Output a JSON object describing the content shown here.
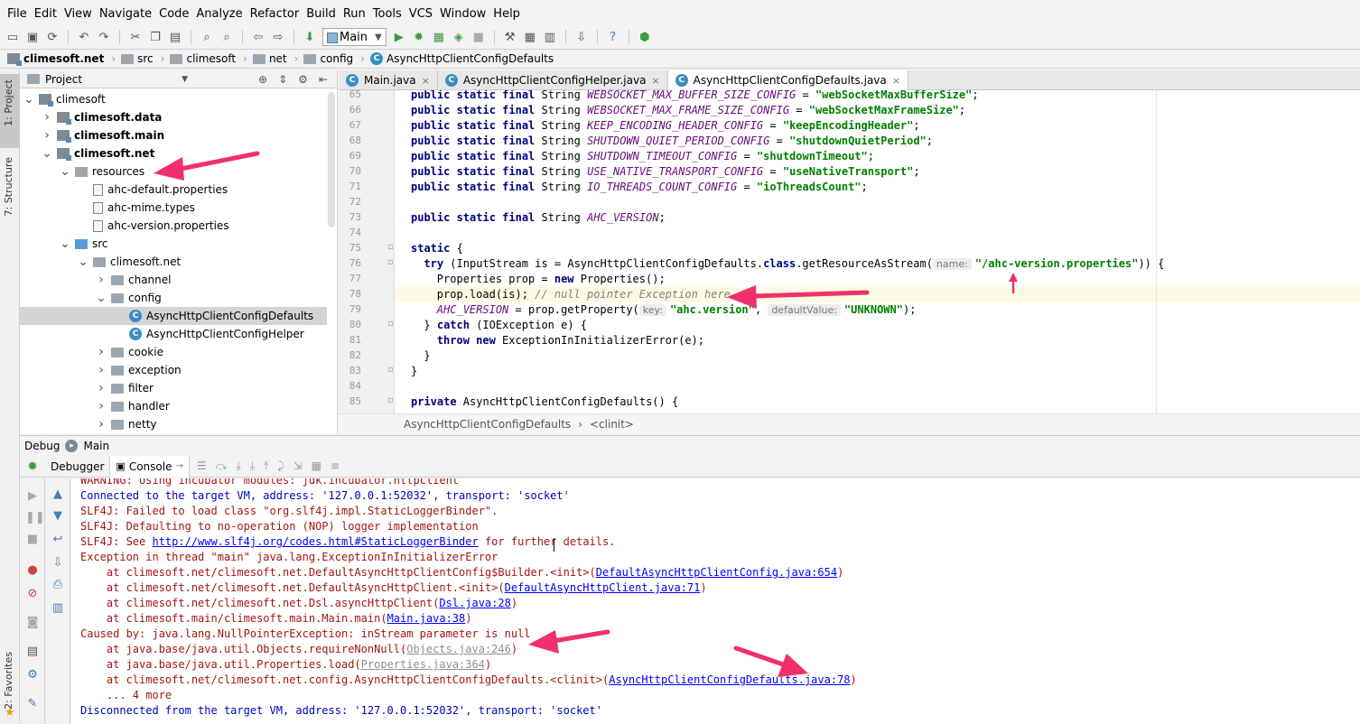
{
  "menu": [
    "File",
    "Edit",
    "View",
    "Navigate",
    "Code",
    "Analyze",
    "Refactor",
    "Build",
    "Run",
    "Tools",
    "VCS",
    "Window",
    "Help"
  ],
  "toolbar": {
    "run_config": "Main"
  },
  "breadcrumbs": [
    "climesoft.net",
    "src",
    "climesoft",
    "net",
    "config",
    "AsyncHttpClientConfigDefaults"
  ],
  "left_strip": {
    "project": "1: Project",
    "structure": "7: Structure",
    "favorites": "2: Favorites"
  },
  "project": {
    "title": "Project",
    "tree": [
      {
        "label": "climesoft",
        "depth": 0,
        "expanded": true,
        "icon": "module"
      },
      {
        "label": "climesoft.data",
        "depth": 1,
        "expanded": false,
        "icon": "module",
        "bold": true
      },
      {
        "label": "climesoft.main",
        "depth": 1,
        "expanded": false,
        "icon": "module",
        "bold": true
      },
      {
        "label": "climesoft.net",
        "depth": 1,
        "expanded": true,
        "icon": "module",
        "bold": true
      },
      {
        "label": "resources",
        "depth": 2,
        "expanded": true,
        "icon": "resources"
      },
      {
        "label": "ahc-default.properties",
        "depth": 3,
        "icon": "file"
      },
      {
        "label": "ahc-mime.types",
        "depth": 3,
        "icon": "file"
      },
      {
        "label": "ahc-version.properties",
        "depth": 3,
        "icon": "file"
      },
      {
        "label": "src",
        "depth": 2,
        "expanded": true,
        "icon": "src"
      },
      {
        "label": "climesoft.net",
        "depth": 3,
        "expanded": true,
        "icon": "folder"
      },
      {
        "label": "channel",
        "depth": 4,
        "expanded": false,
        "icon": "folder"
      },
      {
        "label": "config",
        "depth": 4,
        "expanded": true,
        "icon": "folder"
      },
      {
        "label": "AsyncHttpClientConfigDefaults",
        "depth": 5,
        "icon": "class",
        "selected": true
      },
      {
        "label": "AsyncHttpClientConfigHelper",
        "depth": 5,
        "icon": "class"
      },
      {
        "label": "cookie",
        "depth": 4,
        "expanded": false,
        "icon": "folder"
      },
      {
        "label": "exception",
        "depth": 4,
        "expanded": false,
        "icon": "folder"
      },
      {
        "label": "filter",
        "depth": 4,
        "expanded": false,
        "icon": "folder"
      },
      {
        "label": "handler",
        "depth": 4,
        "expanded": false,
        "icon": "folder"
      },
      {
        "label": "netty",
        "depth": 4,
        "expanded": false,
        "icon": "folder"
      }
    ]
  },
  "editor": {
    "tabs": [
      {
        "label": "Main.java",
        "active": false
      },
      {
        "label": "AsyncHttpClientConfigHelper.java",
        "active": false
      },
      {
        "label": "AsyncHttpClientConfigDefaults.java",
        "active": true
      }
    ],
    "lines": [
      {
        "n": "65",
        "indent": 0,
        "parts": [
          [
            "kw",
            "public static final "
          ],
          [
            "",
            "String "
          ],
          [
            "const",
            "WEBSOCKET_MAX_BUFFER_SIZE_CONFIG"
          ],
          [
            "",
            " = "
          ],
          [
            "str",
            "\"webSocketMaxBufferSize\""
          ],
          [
            "",
            ";"
          ]
        ]
      },
      {
        "n": "66",
        "indent": 0,
        "parts": [
          [
            "kw",
            "public static final "
          ],
          [
            "",
            "String "
          ],
          [
            "const",
            "WEBSOCKET_MAX_FRAME_SIZE_CONFIG"
          ],
          [
            "",
            " = "
          ],
          [
            "str",
            "\"webSocketMaxFrameSize\""
          ],
          [
            "",
            ";"
          ]
        ]
      },
      {
        "n": "67",
        "indent": 0,
        "parts": [
          [
            "kw",
            "public static final "
          ],
          [
            "",
            "String "
          ],
          [
            "const",
            "KEEP_ENCODING_HEADER_CONFIG"
          ],
          [
            "",
            " = "
          ],
          [
            "str",
            "\"keepEncodingHeader\""
          ],
          [
            "",
            ";"
          ]
        ]
      },
      {
        "n": "68",
        "indent": 0,
        "parts": [
          [
            "kw",
            "public static final "
          ],
          [
            "",
            "String "
          ],
          [
            "const",
            "SHUTDOWN_QUIET_PERIOD_CONFIG"
          ],
          [
            "",
            " = "
          ],
          [
            "str",
            "\"shutdownQuietPeriod\""
          ],
          [
            "",
            ";"
          ]
        ]
      },
      {
        "n": "69",
        "indent": 0,
        "parts": [
          [
            "kw",
            "public static final "
          ],
          [
            "",
            "String "
          ],
          [
            "const",
            "SHUTDOWN_TIMEOUT_CONFIG"
          ],
          [
            "",
            " = "
          ],
          [
            "str",
            "\"shutdownTimeout\""
          ],
          [
            "",
            ";"
          ]
        ]
      },
      {
        "n": "70",
        "indent": 0,
        "parts": [
          [
            "kw",
            "public static final "
          ],
          [
            "",
            "String "
          ],
          [
            "const",
            "USE_NATIVE_TRANSPORT_CONFIG"
          ],
          [
            "",
            " = "
          ],
          [
            "str",
            "\"useNativeTransport\""
          ],
          [
            "",
            ";"
          ]
        ]
      },
      {
        "n": "71",
        "indent": 0,
        "parts": [
          [
            "kw",
            "public static final "
          ],
          [
            "",
            "String "
          ],
          [
            "const",
            "IO_THREADS_COUNT_CONFIG"
          ],
          [
            "",
            " = "
          ],
          [
            "str",
            "\"ioThreadsCount\""
          ],
          [
            "",
            ";"
          ]
        ]
      },
      {
        "n": "72",
        "indent": 0,
        "parts": []
      },
      {
        "n": "73",
        "indent": 0,
        "parts": [
          [
            "kw",
            "public static final "
          ],
          [
            "",
            "String "
          ],
          [
            "const",
            "AHC_VERSION"
          ],
          [
            "",
            ";"
          ]
        ]
      },
      {
        "n": "74",
        "indent": 0,
        "parts": []
      },
      {
        "n": "75",
        "indent": 0,
        "parts": [
          [
            "kw",
            "static "
          ],
          [
            "",
            "{"
          ]
        ]
      },
      {
        "n": "76",
        "indent": 2,
        "parts": [
          [
            "kw",
            "try "
          ],
          [
            "",
            "(InputStream is = AsyncHttpClientConfigDefaults."
          ],
          [
            "kw",
            "class"
          ],
          [
            "",
            ".getResourceAsStream("
          ],
          [
            "hint",
            "name:"
          ],
          [
            "str",
            "\"/ahc-version.properties\""
          ],
          [
            "",
            "))"
          ],
          [
            "",
            " {"
          ]
        ]
      },
      {
        "n": "77",
        "indent": 4,
        "parts": [
          [
            "",
            "Properties prop = "
          ],
          [
            "kw",
            "new "
          ],
          [
            "",
            "Properties();"
          ]
        ]
      },
      {
        "n": "78",
        "indent": 4,
        "parts": [
          [
            "",
            "prop.load(is); "
          ],
          [
            "cmt",
            "// null pointer Exception here"
          ]
        ]
      },
      {
        "n": "79",
        "indent": 4,
        "parts": [
          [
            "const",
            "AHC_VERSION"
          ],
          [
            "",
            " = prop.getProperty("
          ],
          [
            "hint",
            "key:"
          ],
          [
            "str",
            "\"ahc.version\""
          ],
          [
            "",
            ", "
          ],
          [
            "hint",
            "defaultValue:"
          ],
          [
            "str",
            "\"UNKNOWN\""
          ],
          [
            "",
            ");"
          ]
        ]
      },
      {
        "n": "80",
        "indent": 2,
        "parts": [
          [
            "",
            "} "
          ],
          [
            "kw",
            "catch "
          ],
          [
            "",
            "(IOException e) {"
          ]
        ]
      },
      {
        "n": "81",
        "indent": 4,
        "parts": [
          [
            "kw",
            "throw new "
          ],
          [
            "",
            "ExceptionInInitializerError(e);"
          ]
        ]
      },
      {
        "n": "82",
        "indent": 2,
        "parts": [
          [
            "",
            "}"
          ]
        ]
      },
      {
        "n": "83",
        "indent": 0,
        "parts": [
          [
            "",
            "}"
          ]
        ]
      },
      {
        "n": "84",
        "indent": 0,
        "parts": []
      },
      {
        "n": "85",
        "indent": 0,
        "parts": [
          [
            "kw",
            "private "
          ],
          [
            "",
            "AsyncHttpClientConfigDefaults() {"
          ]
        ]
      }
    ],
    "crumbs": [
      "AsyncHttpClientConfigDefaults",
      "<clinit>"
    ]
  },
  "debug": {
    "title": "Debug",
    "config": "Main",
    "tabs": [
      "Debugger",
      "Console"
    ]
  },
  "console": [
    {
      "style": "",
      "parts": [
        [
          "",
          "WARNING: Using incubator modules: jdk.incubator.httpclient"
        ]
      ]
    },
    {
      "style": "blue",
      "parts": [
        [
          "",
          "Connected to the target VM, address: '127.0.0.1:52032', transport: 'socket'"
        ]
      ]
    },
    {
      "style": "",
      "parts": [
        [
          "",
          "SLF4J: Failed to load class \"org.slf4j.impl.StaticLoggerBinder\"."
        ]
      ]
    },
    {
      "style": "",
      "parts": [
        [
          "",
          "SLF4J: Defaulting to no-operation (NOP) logger implementation"
        ]
      ]
    },
    {
      "style": "",
      "parts": [
        [
          "",
          "SLF4J: See "
        ],
        [
          "lnk",
          "http://www.slf4j.org/codes.html#StaticLoggerBinder"
        ],
        [
          "",
          " for further details."
        ]
      ]
    },
    {
      "style": "",
      "parts": [
        [
          "",
          "Exception in thread \"main\" java.lang.ExceptionInInitializerError"
        ]
      ]
    },
    {
      "style": "",
      "parts": [
        [
          "",
          "\tat climesoft.net/climesoft.net.DefaultAsyncHttpClientConfig$Builder.<init>("
        ],
        [
          "lnk",
          "DefaultAsyncHttpClientConfig.java:654"
        ],
        [
          "",
          ")"
        ]
      ]
    },
    {
      "style": "",
      "parts": [
        [
          "",
          "\tat climesoft.net/climesoft.net.DefaultAsyncHttpClient.<init>("
        ],
        [
          "lnk",
          "DefaultAsyncHttpClient.java:71"
        ],
        [
          "",
          ")"
        ]
      ]
    },
    {
      "style": "",
      "parts": [
        [
          "",
          "\tat climesoft.net/climesoft.net.Dsl.asyncHttpClient("
        ],
        [
          "lnk",
          "Dsl.java:28"
        ],
        [
          "",
          ")"
        ]
      ]
    },
    {
      "style": "",
      "parts": [
        [
          "",
          "\tat climesoft.main/climesoft.main.Main.main("
        ],
        [
          "lnk",
          "Main.java:38"
        ],
        [
          "",
          ")"
        ]
      ]
    },
    {
      "style": "",
      "parts": [
        [
          "",
          "Caused by: java.lang.NullPointerException: inStream parameter is null"
        ]
      ]
    },
    {
      "style": "",
      "parts": [
        [
          "",
          "\tat java.base/java.util.Objects.requireNonNull("
        ],
        [
          "lnk gray",
          "Objects.java:246"
        ],
        [
          "",
          ")"
        ]
      ]
    },
    {
      "style": "",
      "parts": [
        [
          "",
          "\tat java.base/java.util.Properties.load("
        ],
        [
          "lnk gray",
          "Properties.java:364"
        ],
        [
          "",
          ")"
        ]
      ]
    },
    {
      "style": "",
      "parts": [
        [
          "",
          "\tat climesoft.net/climesoft.net.config.AsyncHttpClientConfigDefaults.<clinit>("
        ],
        [
          "lnk",
          "AsyncHttpClientConfigDefaults.java:78"
        ],
        [
          "",
          ")"
        ]
      ]
    },
    {
      "style": "",
      "parts": [
        [
          "",
          "\t... 4 more"
        ]
      ]
    },
    {
      "style": "blue",
      "parts": [
        [
          "",
          "Disconnected from the target VM, address: '127.0.0.1:52032', transport: 'socket'"
        ]
      ]
    }
  ],
  "colors": {
    "annotation_arrow": "#f0306a",
    "keyword": "#000080",
    "constant": "#660e7a",
    "string": "#008000",
    "console_text": "#a31515"
  }
}
